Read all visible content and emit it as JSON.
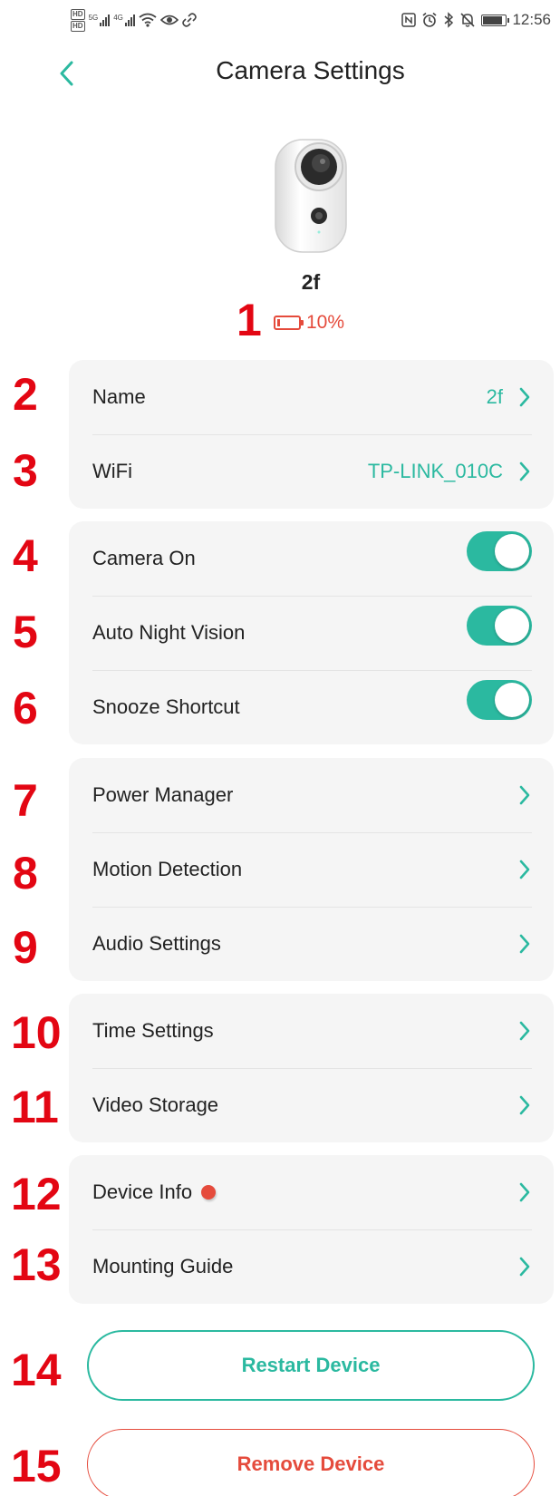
{
  "status_bar": {
    "hd_top": "HD",
    "hd_bottom": "HD",
    "net1": "5G",
    "net2": "4G",
    "time": "12:56",
    "icons": [
      "hd-icon",
      "signal-icon",
      "wifi-icon",
      "eye-icon",
      "link-icon",
      "nfc-icon",
      "alarm-icon",
      "bluetooth-icon",
      "mute-icon",
      "battery-icon"
    ]
  },
  "header": {
    "title": "Camera Settings",
    "back_icon": "chevron-left-icon"
  },
  "device": {
    "name": "2f",
    "battery_text": "10%",
    "battery_level": 0.1
  },
  "markers": [
    "1",
    "2",
    "3",
    "4",
    "5",
    "6",
    "7",
    "8",
    "9",
    "10",
    "11",
    "12",
    "13",
    "14",
    "15"
  ],
  "groups": {
    "network": [
      {
        "label": "Name",
        "value": "2f"
      },
      {
        "label": "WiFi",
        "value": "TP-LINK_010C"
      }
    ],
    "toggles": [
      {
        "label": "Camera On",
        "on": true
      },
      {
        "label": "Auto Night Vision",
        "on": true
      },
      {
        "label": "Snooze Shortcut",
        "on": true
      }
    ],
    "detection": [
      {
        "label": "Power Manager"
      },
      {
        "label": "Motion Detection"
      },
      {
        "label": "Audio Settings"
      }
    ],
    "storage": [
      {
        "label": "Time Settings"
      },
      {
        "label": "Video Storage"
      }
    ],
    "info": [
      {
        "label": "Device Info",
        "badge": "red-dot"
      },
      {
        "label": "Mounting Guide"
      }
    ]
  },
  "buttons": {
    "restart": "Restart Device",
    "remove": "Remove Device"
  },
  "colors": {
    "accent": "#2bb9a0",
    "danger": "#e54b3c",
    "marker": "#e30613",
    "group_bg": "#f5f5f5"
  }
}
